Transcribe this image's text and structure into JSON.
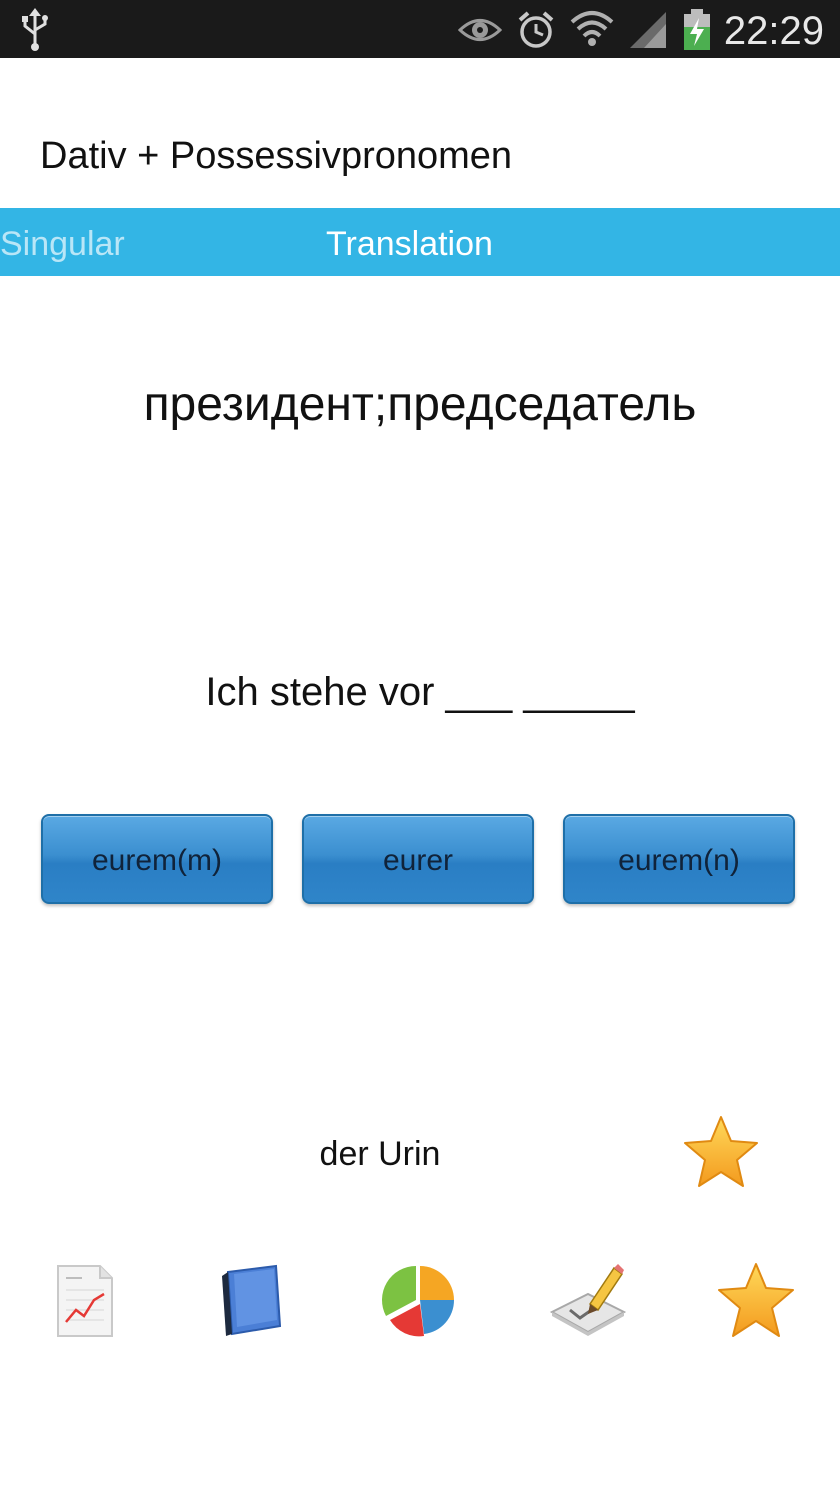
{
  "status_bar": {
    "time": "22:29",
    "icons": [
      "usb-icon",
      "eye-icon",
      "alarm-icon",
      "wifi-icon",
      "signal-icon",
      "battery-charging-icon"
    ]
  },
  "app": {
    "title": "Dativ + Possessivpronomen"
  },
  "tabs": [
    {
      "label": "Singular",
      "active": false
    },
    {
      "label": "Translation",
      "active": true
    }
  ],
  "quiz": {
    "word": "президент;председатель",
    "sentence": "Ich stehe vor ___ _____",
    "options": [
      "eurem(m)",
      "eurer",
      "eurem(n)"
    ]
  },
  "hint": {
    "text": "der Urin",
    "favorite_icon": "star-icon"
  },
  "bottom_bar": {
    "icons": [
      "report-chart-icon",
      "book-icon",
      "pie-chart-icon",
      "edit-checklist-icon",
      "star-icon"
    ]
  },
  "colors": {
    "tab_bar": "#33b5e5",
    "button": "#3b8fd0",
    "status_bar": "#1a1a1a"
  }
}
